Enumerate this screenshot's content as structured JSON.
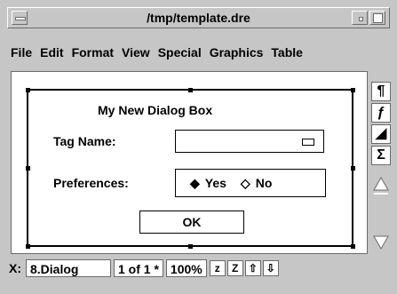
{
  "window": {
    "title": "/tmp/template.dre"
  },
  "menubar": {
    "items": [
      "File",
      "Edit",
      "Format",
      "View",
      "Special",
      "Graphics",
      "Table"
    ]
  },
  "dialog": {
    "title": "My New Dialog Box",
    "tag_label": "Tag Name:",
    "pref_label": "Preferences:",
    "yes_label": "Yes",
    "no_label": "No",
    "ok_label": "OK"
  },
  "toolbar": {
    "items": [
      "¶",
      "ƒ",
      "◢",
      "Σ"
    ]
  },
  "status": {
    "label": "X:",
    "name": "8.Dialog",
    "page": "1 of 1 *",
    "zoom": "100%",
    "icon_z": "z",
    "icon_Z": "Z"
  }
}
